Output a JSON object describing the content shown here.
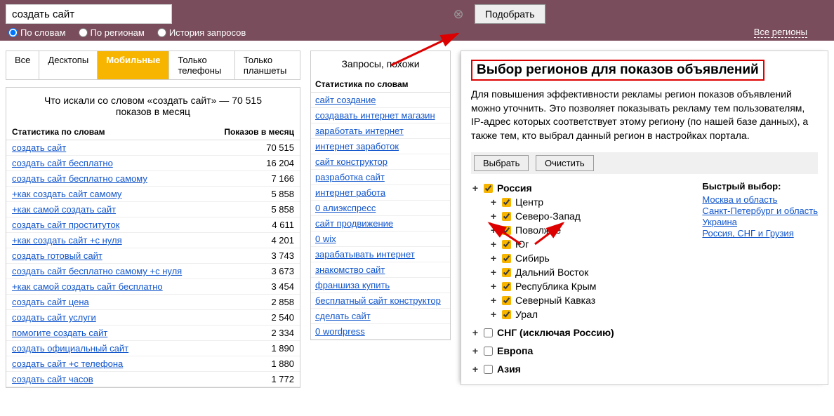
{
  "search": {
    "value": "создать сайт",
    "submit": "Подобрать"
  },
  "radios": {
    "words": "По словам",
    "regions": "По регионам",
    "history": "История запросов",
    "allregions": "Все регионы"
  },
  "tabs": [
    "Все",
    "Десктопы",
    "Мобильные",
    "Только телефоны",
    "Только планшеты"
  ],
  "leftPanel": {
    "titlePrefix": "Что искали со словом «создать сайт» —",
    "titleCount": "70 515",
    "titleSuffix": "показов в месяц",
    "headWord": "Статистика по словам",
    "headCount": "Показов в месяц",
    "rows": [
      {
        "kw": "создать сайт",
        "cnt": "70 515"
      },
      {
        "kw": "создать сайт бесплатно",
        "cnt": "16 204"
      },
      {
        "kw": "создать сайт бесплатно самому",
        "cnt": "7 166"
      },
      {
        "kw": "+как создать сайт самому",
        "cnt": "5 858"
      },
      {
        "kw": "+как самой создать сайт",
        "cnt": "5 858"
      },
      {
        "kw": "создать сайт проституток",
        "cnt": "4 611"
      },
      {
        "kw": "+как создать сайт +с нуля",
        "cnt": "4 201"
      },
      {
        "kw": "создать готовый сайт",
        "cnt": "3 743"
      },
      {
        "kw": "создать сайт бесплатно самому +с нуля",
        "cnt": "3 673"
      },
      {
        "kw": "+как самой создать сайт бесплатно",
        "cnt": "3 454"
      },
      {
        "kw": "создать сайт цена",
        "cnt": "2 858"
      },
      {
        "kw": "создать сайт услуги",
        "cnt": "2 540"
      },
      {
        "kw": "помогите создать сайт",
        "cnt": "2 334"
      },
      {
        "kw": "создать официальный сайт",
        "cnt": "1 890"
      },
      {
        "kw": "создать сайт +с телефона",
        "cnt": "1 880"
      },
      {
        "kw": "создать сайт часов",
        "cnt": "1 772"
      }
    ]
  },
  "midPanel": {
    "title": "Запросы, похожи",
    "headWord": "Статистика по словам",
    "rows": [
      "сайт создание",
      "создавать интернет магазин",
      "заработать интернет",
      "интернет заработок",
      "сайт конструктор",
      "разработка сайт",
      "интернет работа",
      "0 алиэкспресс",
      "сайт продвижение",
      "0 wix",
      "зарабатывать интернет",
      "знакомство сайт",
      "франшиза купить",
      "бесплатный сайт конструктор",
      "сделать сайт",
      "0 wordpress"
    ]
  },
  "rightPanel": {
    "title": "Выбор регионов для показов объявлений",
    "desc": "Для повышения эффективности рекламы регион показов объявлений можно уточнить. Это позволяет показывать рекламу тем пользователям, IP-адрес которых соответствует этому региону (по нашей базе данных), а также тем, кто выбрал данный регион в настройках портала.",
    "btnSelect": "Выбрать",
    "btnClear": "Очистить",
    "tree": {
      "russia": "Россия",
      "subs": [
        "Центр",
        "Северо-Запад",
        "Поволжье",
        "Юг",
        "Сибирь",
        "Дальний Восток",
        "Республика Крым",
        "Северный Кавказ",
        "Урал"
      ],
      "others": [
        "СНГ (исключая Россию)",
        "Европа",
        "Азия"
      ]
    },
    "quick": {
      "title": "Быстрый выбор:",
      "links": [
        "Москва и область",
        "Санкт-Петербург и область",
        "Украина",
        "Россия, СНГ и Грузия"
      ]
    }
  }
}
